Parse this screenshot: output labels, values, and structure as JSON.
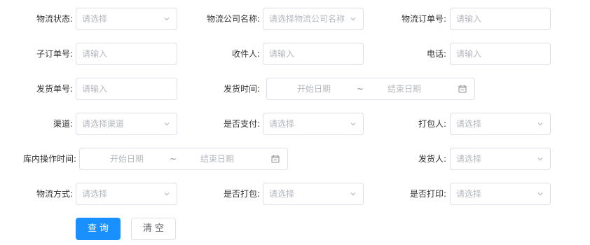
{
  "filters": {
    "logistics_status": {
      "label": "物流状态:",
      "placeholder": "请选择"
    },
    "logistics_company": {
      "label": "物流公司名称:",
      "placeholder": "请选择物流公司名称"
    },
    "logistics_order_no": {
      "label": "物流订单号:",
      "placeholder": "请输入"
    },
    "sub_order_no": {
      "label": "子订单号:",
      "placeholder": "请输入"
    },
    "recipient": {
      "label": "收件人:",
      "placeholder": "请输入"
    },
    "phone": {
      "label": "电话:",
      "placeholder": "请输入"
    },
    "shipment_no": {
      "label": "发货单号:",
      "placeholder": "请输入"
    },
    "ship_time": {
      "label": "发货时间:",
      "start_placeholder": "开始日期",
      "separator": "~",
      "end_placeholder": "结束日期"
    },
    "channel": {
      "label": "渠道:",
      "placeholder": "请选择渠道"
    },
    "is_paid": {
      "label": "是否支付:",
      "placeholder": "请选择"
    },
    "packer": {
      "label": "打包人:",
      "placeholder": "请选择"
    },
    "warehouse_op_time": {
      "label": "库内操作时间:",
      "start_placeholder": "开始日期",
      "separator": "~",
      "end_placeholder": "结束日期"
    },
    "shipper": {
      "label": "发货人:",
      "placeholder": "请选择"
    },
    "logistics_method": {
      "label": "物流方式:",
      "placeholder": "请选择"
    },
    "is_packed": {
      "label": "是否打包:",
      "placeholder": "请选择"
    },
    "is_printed": {
      "label": "是否打印:",
      "placeholder": "请选择"
    }
  },
  "actions": {
    "query_label": "查询",
    "clear_label": "清空"
  },
  "colors": {
    "primary": "#1890ff",
    "border": "#dcdfe6",
    "placeholder": "#b4b7bd"
  }
}
